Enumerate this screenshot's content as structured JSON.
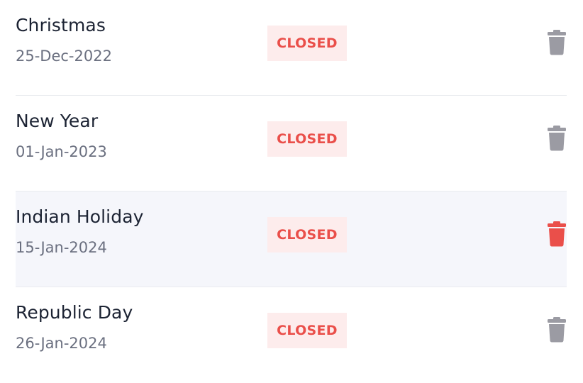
{
  "colors": {
    "text_primary": "#1c2333",
    "text_secondary": "#6b7080",
    "badge_bg": "#fdecec",
    "badge_text": "#ea4f4a",
    "icon_default": "#9b9ba3",
    "icon_active": "#ea4f4a",
    "hover_bg": "#f5f6fb"
  },
  "holidays": [
    {
      "name": "Christmas",
      "date": "25-Dec-2022",
      "status": "CLOSED",
      "icon": "trash-icon",
      "active": false
    },
    {
      "name": "New Year",
      "date": "01-Jan-2023",
      "status": "CLOSED",
      "icon": "trash-icon",
      "active": false
    },
    {
      "name": "Indian Holiday",
      "date": "15-Jan-2024",
      "status": "CLOSED",
      "icon": "trash-icon",
      "active": true
    },
    {
      "name": "Republic Day",
      "date": "26-Jan-2024",
      "status": "CLOSED",
      "icon": "trash-icon",
      "active": false
    }
  ]
}
